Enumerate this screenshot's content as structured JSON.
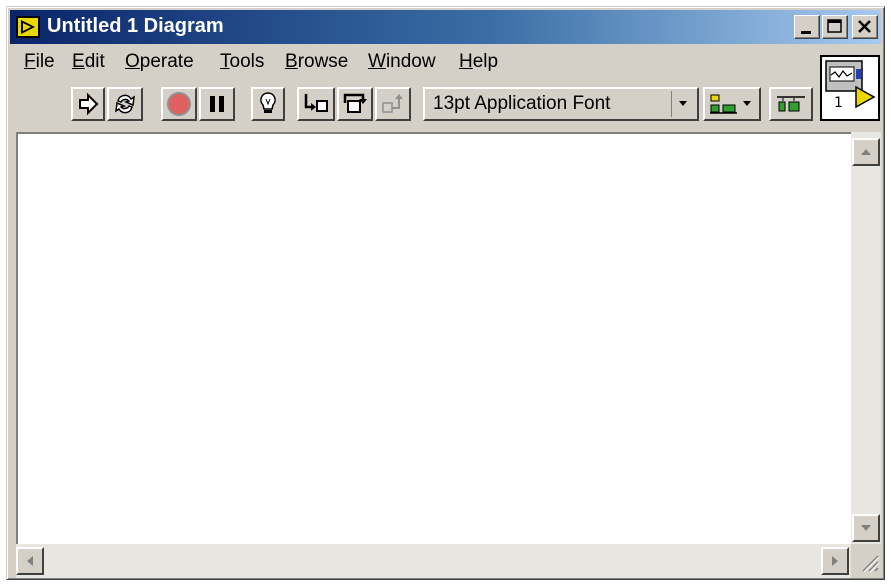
{
  "window": {
    "title": "Untitled 1 Diagram"
  },
  "menu": [
    {
      "label": "File",
      "accel": "F",
      "rest": "ile"
    },
    {
      "label": "Edit",
      "accel": "E",
      "rest": "dit"
    },
    {
      "label": "Operate",
      "accel": "O",
      "rest": "perate"
    },
    {
      "label": "Tools",
      "accel": "T",
      "rest": "ools"
    },
    {
      "label": "Browse",
      "accel": "B",
      "rest": "rowse"
    },
    {
      "label": "Window",
      "accel": "W",
      "rest": "indow"
    },
    {
      "label": "Help",
      "accel": "H",
      "rest": "elp"
    }
  ],
  "toolbar": {
    "font": "13pt Application Font",
    "buttons": [
      "run-arrow-icon",
      "run-continuously-icon",
      "abort-icon",
      "pause-icon",
      "highlight-execution-icon",
      "step-into-icon",
      "step-over-icon",
      "step-out-icon",
      "align-objects-icon",
      "distribute-objects-icon"
    ]
  },
  "vi_icon": {
    "number": "1"
  },
  "colors": {
    "titlebar_start": "#0a246a",
    "titlebar_end": "#a6caf0",
    "face": "#d4d0c8",
    "abort_red": "#e06060"
  }
}
